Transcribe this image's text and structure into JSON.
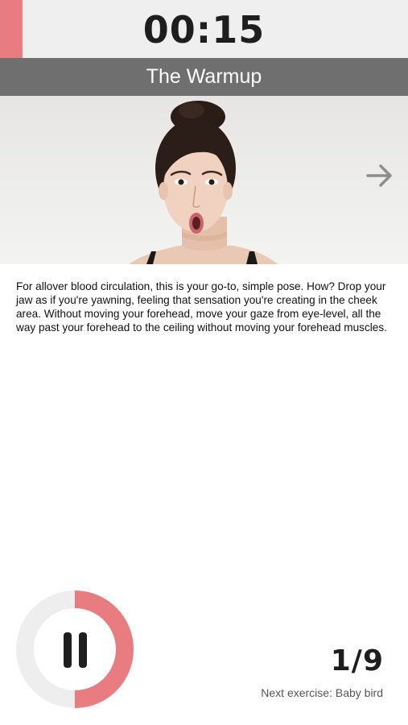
{
  "timer": {
    "display": "00:15",
    "progress_fraction": 0.055
  },
  "exercise": {
    "title": "The Warmup",
    "description": "For allover blood circulation, this is your go-to, simple pose. How? Drop your jaw as if you're yawning, feeling that sensation you're creating in the cheek area. Without moving your forehead, move your gaze from eye-level, all the way past your forehead to the ceiling without moving your forehead muscles."
  },
  "navigation": {
    "next_icon": "arrow-right-icon"
  },
  "controls": {
    "pause_icon": "pause-icon",
    "ring_progress_fraction": 0.5
  },
  "progress": {
    "counter": "1/9",
    "next_exercise": "Next exercise: Baby bird"
  },
  "colors": {
    "accent": "#e87c80",
    "title_band": "#6f6f6f",
    "timer_bg": "#efefef",
    "ring_track": "#eeeeee",
    "text_dark": "#1e1e1e"
  }
}
